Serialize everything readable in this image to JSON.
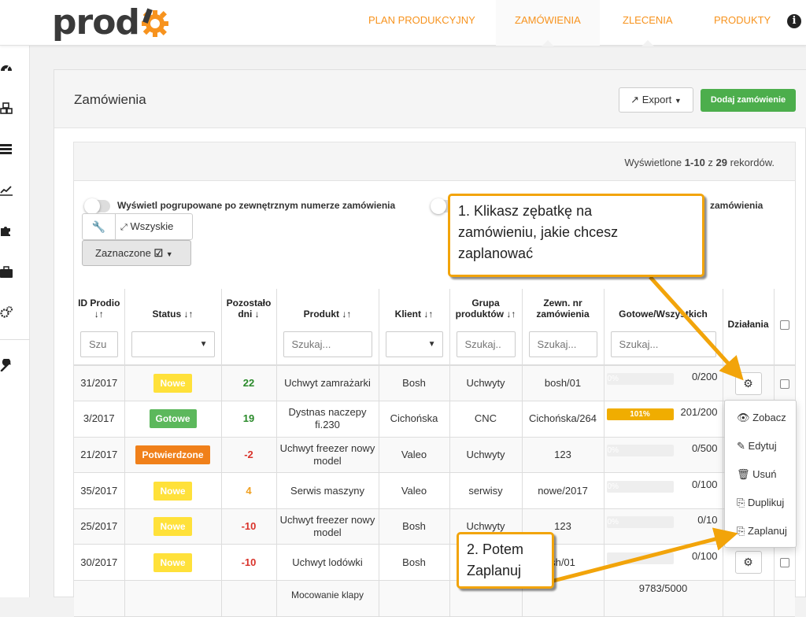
{
  "brand": {
    "name": "prod",
    "colors": {
      "accent": "#f7931e",
      "green": "#4cae4c",
      "callout": "#f2a40a"
    }
  },
  "nav": [
    {
      "label": "PLAN PRODUKCYJNY",
      "active": false
    },
    {
      "label": "ZAMÓWIENIA",
      "active": true
    },
    {
      "label": "ZLECENIA",
      "active": false
    },
    {
      "label": "PRODUKTY",
      "active": false
    }
  ],
  "info_label": "i",
  "sidebar": {
    "icons": [
      "dashboard-icon",
      "cubes-icon",
      "list-icon",
      "chart-icon",
      "puzzle-icon",
      "briefcase-icon",
      "cogs-icon",
      "wrench-icon"
    ]
  },
  "page": {
    "title": "Zamówienia",
    "export_label": "Export",
    "add_label": "Dodaj zamówienie"
  },
  "records": {
    "prefix": "Wyświetlone ",
    "range": "1-10",
    "mid": " z ",
    "total": "29",
    "suffix": " rekordów."
  },
  "toggles": {
    "group_label": "Wyświetl pogrupowane po zewnętrznym numerze zamówienia",
    "second_label_visible": "zamówienia"
  },
  "tools": {
    "all_label": "Wszyskie",
    "selected_label": "Zaznaczone"
  },
  "table": {
    "headers": {
      "id": "ID Prodio",
      "status": "Status",
      "days": "Pozostało dni",
      "product": "Produkt",
      "client": "Klient",
      "group": "Grupa produktów",
      "ext": "Zewn. nr zamówienia",
      "progress": "Gotowe/Wszystkich",
      "actions": "Działania"
    },
    "filters": {
      "id": "Szu",
      "product": "Szukaj...",
      "group": "Szukaj..",
      "ext": "Szukaj...",
      "progress": "Szukaj..."
    },
    "rows": [
      {
        "id": "31/2017",
        "status": "Nowe",
        "status_type": "nowe",
        "days": "22",
        "days_color": "#2a8a2a",
        "product": "Uchwyt zamrażarki",
        "client": "Bosh",
        "group": "Uchwyty",
        "ext": "bosh/01",
        "pct_label": "0%",
        "pct": 0,
        "ratio": "0/200"
      },
      {
        "id": "3/2017",
        "status": "Gotowe",
        "status_type": "gotowe",
        "days": "19",
        "days_color": "#2a8a2a",
        "product": "Dystnas naczepy fi.230",
        "client": "Cichońska",
        "group": "CNC",
        "ext": "Cichońska/264",
        "pct_label": "101%",
        "pct": 100,
        "ratio": "201/200"
      },
      {
        "id": "21/2017",
        "status": "Potwierdzone",
        "status_type": "potw",
        "days": "-2",
        "days_color": "#d9332b",
        "product": "Uchwyt freezer nowy model",
        "client": "Valeo",
        "group": "Uchwyty",
        "ext": "123",
        "pct_label": "0%",
        "pct": 0,
        "ratio": "0/500"
      },
      {
        "id": "35/2017",
        "status": "Nowe",
        "status_type": "nowe",
        "days": "4",
        "days_color": "#f0a020",
        "product": "Serwis maszyny",
        "client": "Valeo",
        "group": "serwisy",
        "ext": "nowe/2017",
        "pct_label": "0%",
        "pct": 0,
        "ratio": "0/100"
      },
      {
        "id": "25/2017",
        "status": "Nowe",
        "status_type": "nowe",
        "days": "-10",
        "days_color": "#d9332b",
        "product": "Uchwyt freezer nowy model",
        "client": "Bosh",
        "group": "Uchwyty",
        "ext": "123",
        "pct_label": "0%",
        "pct": 0,
        "ratio": "0/10"
      },
      {
        "id": "30/2017",
        "status": "Nowe",
        "status_type": "nowe",
        "days": "-10",
        "days_color": "#d9332b",
        "product": "Uchwyt lodówki",
        "client": "Bosh",
        "group": "",
        "ext": "sh/01",
        "pct_label": "",
        "pct": 0,
        "ratio": "0/100"
      }
    ],
    "partial_row": {
      "product": "Mocowanie klapy",
      "ratio": "9783/5000"
    }
  },
  "dropdown": {
    "items": [
      {
        "label": "Zobacz",
        "icon": "eye-icon"
      },
      {
        "label": "Edytuj",
        "icon": "pencil-icon"
      },
      {
        "label": "Usuń",
        "icon": "trash-icon"
      },
      {
        "label": "Duplikuj",
        "icon": "copy-icon"
      },
      {
        "label": "Zaplanuj",
        "icon": "schedule-icon"
      }
    ]
  },
  "callouts": {
    "step1": [
      "1. Klikasz zębatkę na",
      "zamówieniu, jakie chcesz",
      "zaplanować"
    ],
    "step2": [
      "2. Potem",
      "Zaplanuj"
    ]
  }
}
